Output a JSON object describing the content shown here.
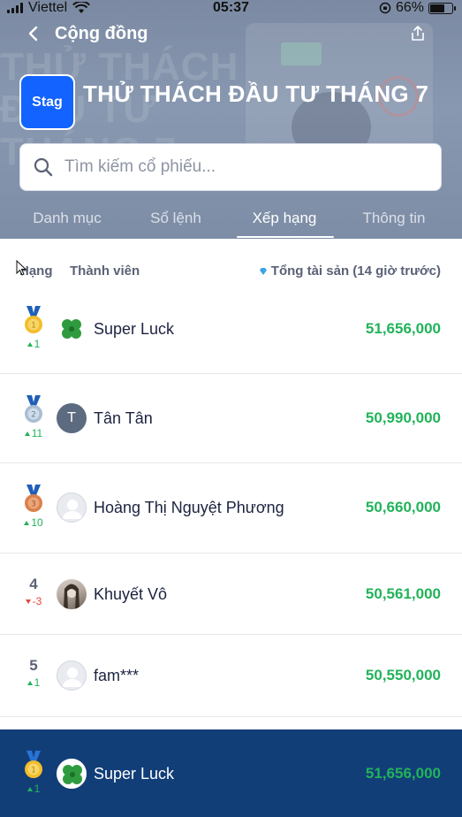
{
  "status_bar": {
    "carrier": "Viettel",
    "time": "05:37",
    "battery": "66%"
  },
  "nav": {
    "title": "Cộng đồng"
  },
  "contest": {
    "logo_text": "Stag",
    "title": "THỬ THÁCH ĐẦU TƯ THÁNG 7",
    "background_text": "THỬ THÁCH\nĐẦU TƯ\nTHÁNG 7"
  },
  "search": {
    "placeholder": "Tìm kiếm cổ phiếu..."
  },
  "tabs": [
    {
      "label": "Danh mục"
    },
    {
      "label": "Sổ lệnh"
    },
    {
      "label": "Xếp hạng",
      "active": true
    },
    {
      "label": "Thông tin"
    }
  ],
  "leaderboard": {
    "headers": {
      "rank": "Hạng",
      "member": "Thành viên",
      "total_assets": "Tổng tài sản (14 giờ trước)"
    },
    "rows": [
      {
        "rank": "1",
        "medal": "gold",
        "change": "1",
        "direction": "up",
        "avatar": "clover",
        "name": "Super Luck",
        "assets": "51,656,000"
      },
      {
        "rank": "2",
        "medal": "silver",
        "change": "11",
        "direction": "up",
        "avatar": "letter",
        "avatar_letter": "T",
        "name": "Tân Tân",
        "assets": "50,990,000"
      },
      {
        "rank": "3",
        "medal": "bronze",
        "change": "10",
        "direction": "up",
        "avatar": "default",
        "name": "Hoàng Thị Nguyệt Phương",
        "assets": "50,660,000"
      },
      {
        "rank": "4",
        "medal": "",
        "change": "-3",
        "direction": "down",
        "avatar": "photo",
        "name": "Khuyết Vô",
        "assets": "50,561,000"
      },
      {
        "rank": "5",
        "medal": "",
        "change": "1",
        "direction": "up",
        "avatar": "default",
        "name": "fam***",
        "assets": "50,550,000"
      }
    ],
    "current_user": {
      "rank": "1",
      "medal": "gold",
      "change": "1",
      "direction": "up",
      "avatar": "clover",
      "name": "Super Luck",
      "assets": "51,656,000"
    }
  },
  "colors": {
    "accent_blue": "#1263ff",
    "header_bg": "#8493ab",
    "positive": "#21b35a",
    "negative": "#e2483d",
    "footer_bg": "#123e78"
  }
}
